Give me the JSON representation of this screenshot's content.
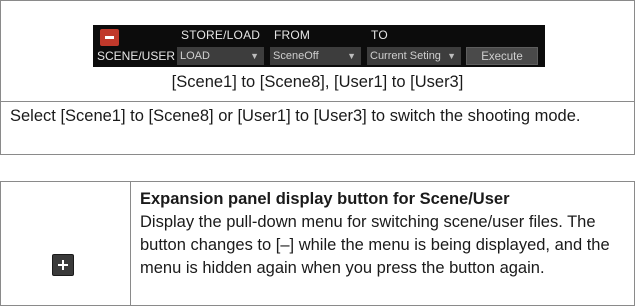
{
  "ui_bar": {
    "headers": {
      "store_load": "STORE/LOAD",
      "from": "FROM",
      "to": "TO"
    },
    "scene_user_label": "SCENE/USER",
    "store_load_value": "LOAD",
    "from_value": "SceneOff",
    "to_value": "Current Seting",
    "execute_label": "Execute",
    "collapse_icon": "minus-icon",
    "dropdown_icon": "triangle-down-icon"
  },
  "caption": "[Scene1] to [Scene8], [User1] to [User3]",
  "description": "Select [Scene1] to [Scene8] or [User1] to [User3] to switch the shooting mode.",
  "expansion": {
    "icon": "plus-icon",
    "title": "Expansion panel display button for Scene/User",
    "body": "Display the pull-down menu for switching scene/user files. The button changes to [–] while the menu is being displayed, and the menu is hidden again when you press the button again."
  },
  "colors": {
    "minus_button": "#c0392b",
    "bar_background": "#0c0c0c",
    "plus_button": "#3a3a3a"
  }
}
